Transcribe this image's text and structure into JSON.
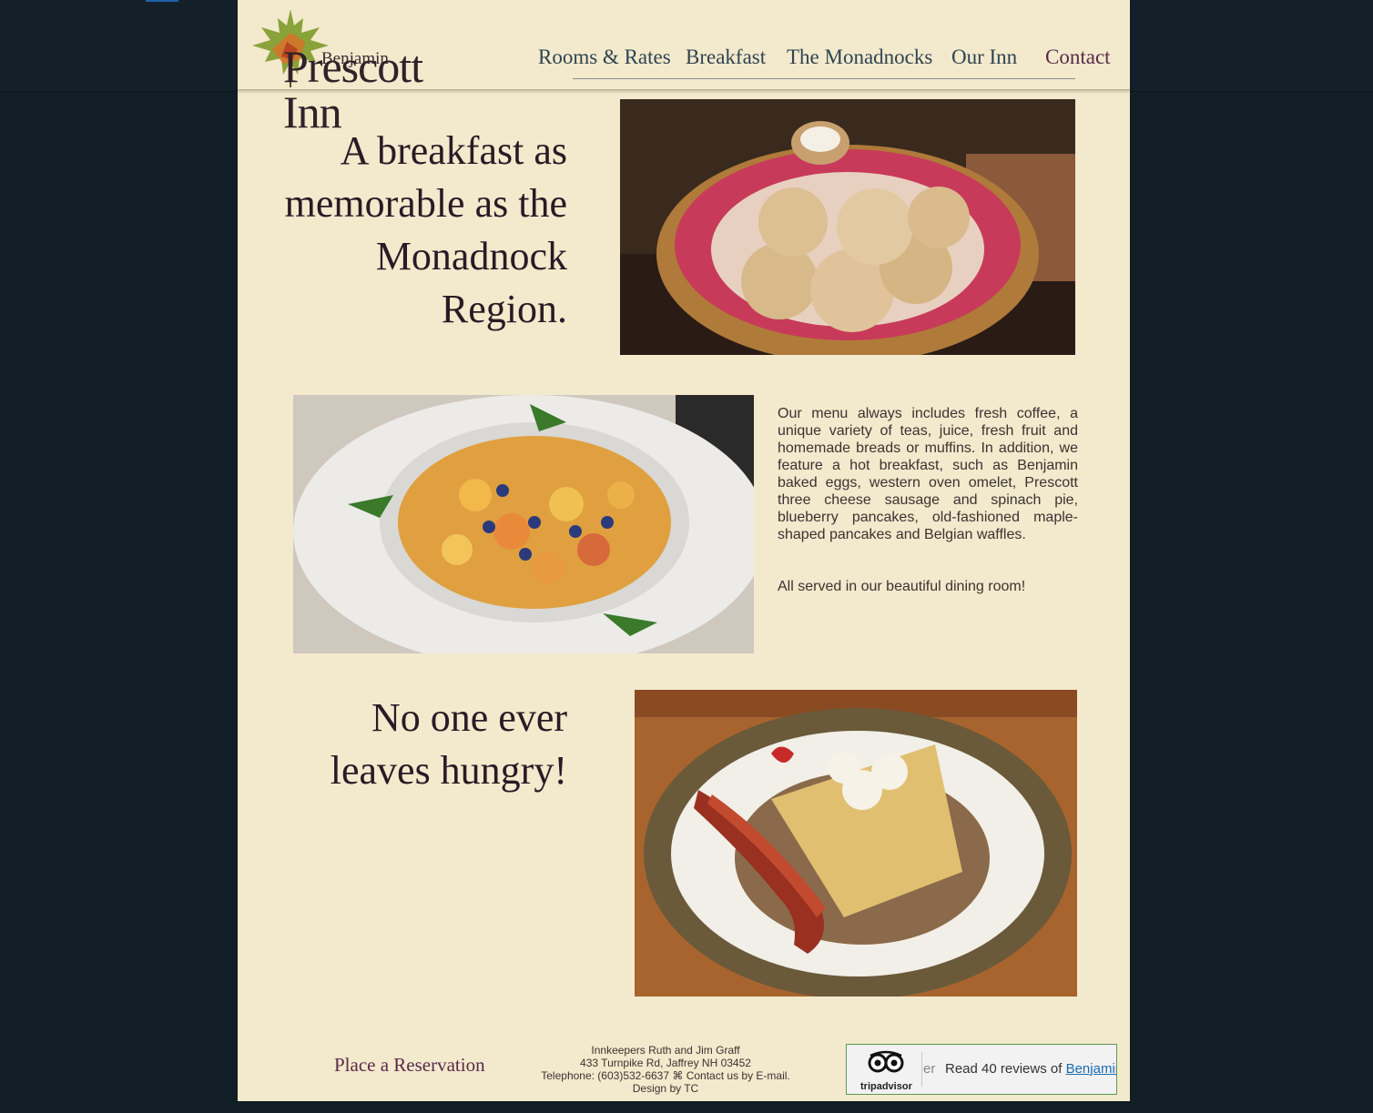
{
  "brand": {
    "logo_small": "Benjamin",
    "logo_big": "Prescott Inn"
  },
  "nav": {
    "items": [
      {
        "label": "Rooms & Rates"
      },
      {
        "label": "Breakfast"
      },
      {
        "label": "The Monadnocks"
      },
      {
        "label": "Our Inn"
      },
      {
        "label": "Contact"
      }
    ]
  },
  "section1": {
    "lines": [
      "A breakfast as",
      "memorable as the",
      "Monadnock",
      "Region."
    ]
  },
  "section2": {
    "paragraph1": "Our menu always includes fresh coffee, a unique variety of teas, juice, fresh fruit and homemade breads or muffins. In addition, we feature a hot breakfast, such as Benjamin baked eggs, western oven omelet, Prescott three cheese sausage and spinach pie, blueberry pancakes, old-fashioned maple-shaped pancakes and Belgian waffles.",
    "paragraph2": "All served in our beautiful dining room!"
  },
  "section3": {
    "lines": [
      "No one ever",
      "leaves hungry!"
    ]
  },
  "footer": {
    "reservation": "Place a Reservation",
    "line1": "Innkeepers Ruth and Jim Graff",
    "line2": "433 Turnpike Rd, Jaffrey NH 03452",
    "line3_prefix": "Telephone: (603)532-6637 ⌘ ",
    "contact_link": "Contact us by E-mail.",
    "line4": "Design by TC"
  },
  "tripadvisor": {
    "brand": "tripadvisor",
    "partial": "er",
    "text": "Read 40 reviews of ",
    "link": "Benjamin Prescott Inn"
  },
  "colors": {
    "page_bg": "#f3e9cc",
    "outer_bg": "#121e26",
    "heading": "#2a1a26",
    "nav": "#2e4452",
    "accent": "#5a2a4a"
  }
}
